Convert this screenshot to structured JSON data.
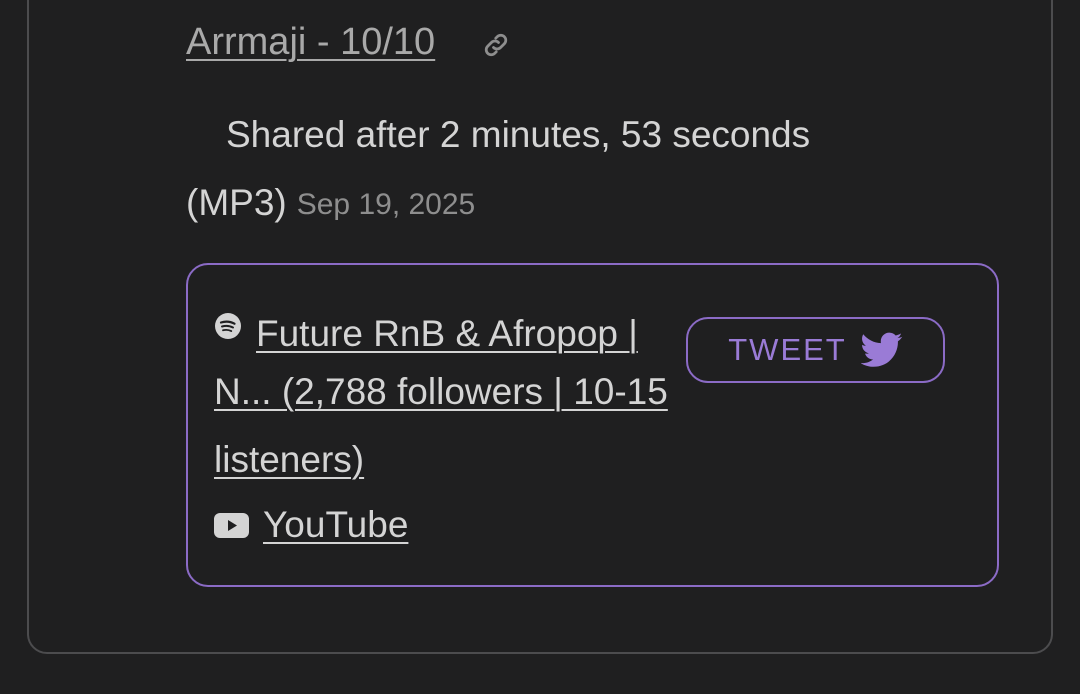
{
  "review": {
    "reviewer_label": "Arrmaji - 10/10",
    "shared_text": "Shared after 2 minutes, 53 seconds",
    "format": "(MP3)",
    "date": "Sep 19, 2025"
  },
  "links": {
    "playlist_line1": "Future RnB & Afropop |",
    "playlist_rest": "N... (2,788 followers | 10-15 listeners)",
    "youtube_label": "YouTube"
  },
  "tweet": {
    "label": "TWEET"
  },
  "colors": {
    "background": "#1f1f20",
    "accent": "#8b6bc6",
    "tweet_text": "#9a7bd6"
  },
  "icons": {
    "link": "link-icon",
    "spotify": "spotify-icon",
    "youtube": "youtube-icon",
    "twitter": "twitter-bird-icon"
  }
}
